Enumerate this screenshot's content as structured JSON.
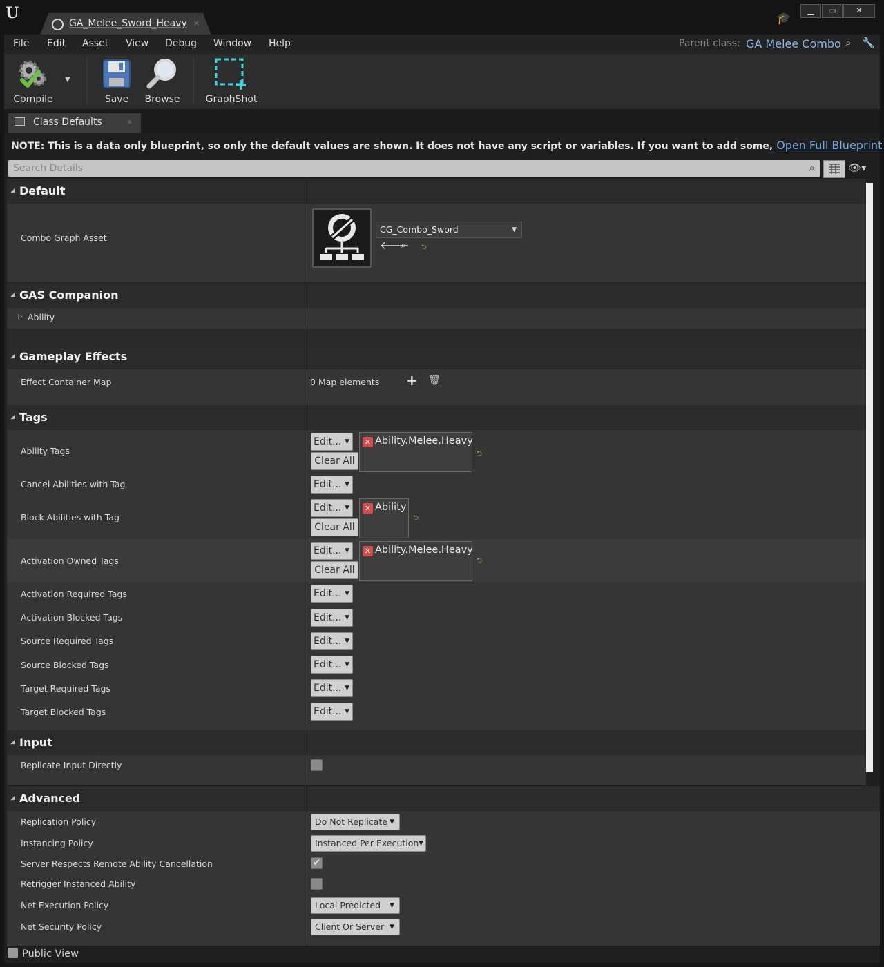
{
  "window": {
    "tab_title": "GA_Melee_Sword_Heavy",
    "tab_close": "×",
    "logo": "U",
    "minimize": "▁",
    "maximize": "▭",
    "close": "✕"
  },
  "menu": [
    "File",
    "Edit",
    "Asset",
    "View",
    "Debug",
    "Window",
    "Help"
  ],
  "parent": {
    "label": "Parent class:",
    "value": "GA Melee Combo"
  },
  "toolbar": {
    "compile": "Compile",
    "save": "Save",
    "browse": "Browse",
    "graphshot": "GraphShot"
  },
  "panel_tab": "Class Defaults",
  "note": {
    "text": "NOTE: This is a data only blueprint, so only the default values are shown.  It does not have any script or variables.  If you want to add some,",
    "link": "Open Full Blueprint Editor"
  },
  "search": {
    "placeholder": "Search Details"
  },
  "categories": {
    "default": "Default",
    "gas": "GAS Companion",
    "effects": "Gameplay Effects",
    "tags": "Tags",
    "input": "Input",
    "advanced": "Advanced"
  },
  "default": {
    "combo_label": "Combo Graph Asset",
    "combo_value": "CG_Combo_Sword"
  },
  "gas": {
    "ability_label": "Ability"
  },
  "effects": {
    "map_label": "Effect Container Map",
    "map_value": "0 Map elements"
  },
  "tag_rows": {
    "ability_tags": "Ability Tags",
    "cancel": "Cancel Abilities with Tag",
    "block": "Block Abilities with Tag",
    "activation_owned": "Activation Owned Tags",
    "activation_required": "Activation Required Tags",
    "activation_blocked": "Activation Blocked Tags",
    "source_required": "Source Required Tags",
    "source_blocked": "Source Blocked Tags",
    "target_required": "Target Required Tags",
    "target_blocked": "Target Blocked Tags"
  },
  "tag_values": {
    "ability_tags": "Ability.Melee.Heavy",
    "block": "Ability",
    "activation_owned": "Ability.Melee.Heavy"
  },
  "buttons": {
    "edit": "Edit...",
    "clear_all": "Clear All"
  },
  "input": {
    "replicate_label": "Replicate Input Directly",
    "replicate_checked": false
  },
  "advanced": {
    "replication_label": "Replication Policy",
    "replication_value": "Do Not Replicate",
    "instancing_label": "Instancing Policy",
    "instancing_value": "Instanced Per Execution",
    "server_label": "Server Respects Remote Ability Cancellation",
    "server_checked": true,
    "retrigger_label": "Retrigger Instanced Ability",
    "retrigger_checked": false,
    "net_exec_label": "Net Execution Policy",
    "net_exec_value": "Local Predicted",
    "net_sec_label": "Net Security Policy",
    "net_sec_value": "Client Or Server"
  },
  "public_view": "Public View",
  "colors": {
    "link": "#77a7e0",
    "parent_class": "#8fb7ea",
    "tag_remove": "#d34b4b",
    "reset_arrow": "#8ac048"
  }
}
